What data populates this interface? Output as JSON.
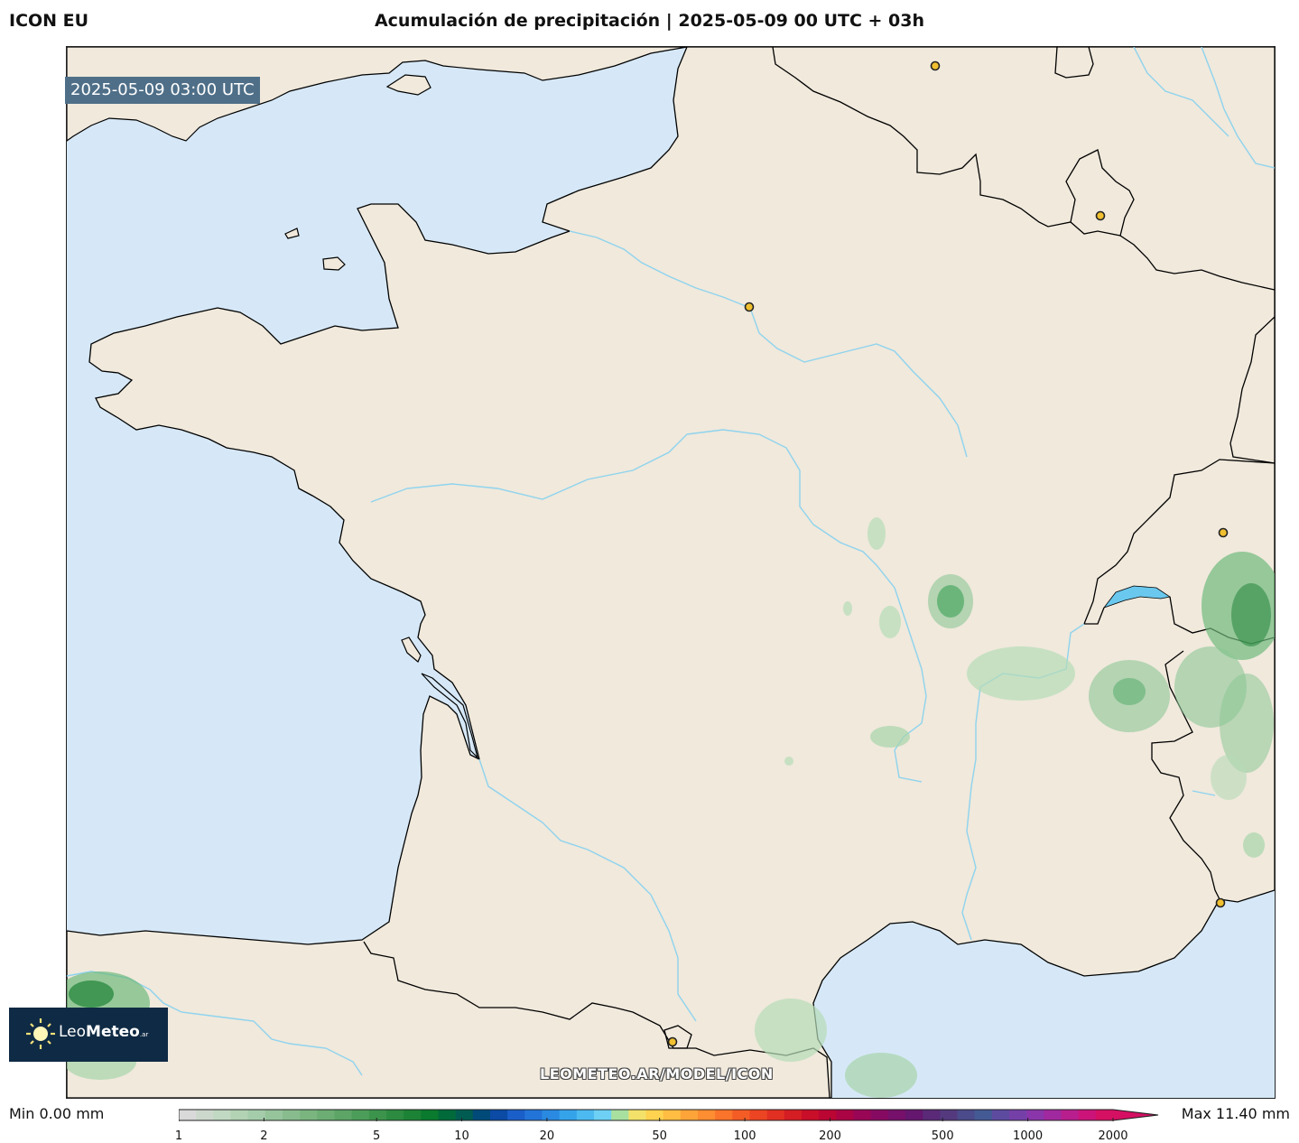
{
  "header": {
    "model": "ICON EU",
    "title": "Acumulación de precipitación | 2025-05-09 00 UTC + 03h"
  },
  "map": {
    "valid_time": "2025-05-09 03:00 UTC",
    "watermark": "LEOMETEO.AR/MODEL/ICON",
    "colors": {
      "sea": "#d6e8f7",
      "land": "#f0e9dc",
      "rivers": "#8ed3ee",
      "borders": "#000000",
      "precip": "#4ca864",
      "cities": "#f0c030"
    }
  },
  "logo": {
    "name_light": "Leo",
    "name_bold": "Meteo",
    "suffix": ".ar",
    "icon": "sun-icon"
  },
  "legend": {
    "min_label": "Min 0.00 mm",
    "max_label": "Max 11.40 mm",
    "ticks": [
      "1",
      "2",
      "5",
      "10",
      "20",
      "50",
      "100",
      "200",
      "500",
      "1000",
      "2000"
    ],
    "colors": [
      "#d9d9d9",
      "#cdd8cd",
      "#c1d8c2",
      "#b2d3b4",
      "#a4ccab",
      "#96c49b",
      "#88bc8e",
      "#7ab580",
      "#6bad73",
      "#5ca566",
      "#4c9d59",
      "#3c944c",
      "#2c8b40",
      "#1c8235",
      "#0a7a2e",
      "#006a3b",
      "#005c52",
      "#004a7a",
      "#0b4aa5",
      "#1a5fc9",
      "#2374d8",
      "#2a8ae2",
      "#35a3ea",
      "#4cbaf0",
      "#6dd0f4",
      "#a8e0a0",
      "#f3e16a",
      "#ffd24f",
      "#ffbd43",
      "#ffa439",
      "#ff8d31",
      "#fb742b",
      "#f45c26",
      "#ec4523",
      "#e13022",
      "#d51d24",
      "#c90e2a",
      "#bb0533",
      "#ab0444",
      "#990656",
      "#870a62",
      "#76106b",
      "#65166f",
      "#5a2a78",
      "#54397f",
      "#4b4a8a",
      "#445a95",
      "#5d4ba0",
      "#7440a8",
      "#8b35aa",
      "#a1299f",
      "#b81e8e",
      "#cb137a",
      "#d51063"
    ]
  }
}
